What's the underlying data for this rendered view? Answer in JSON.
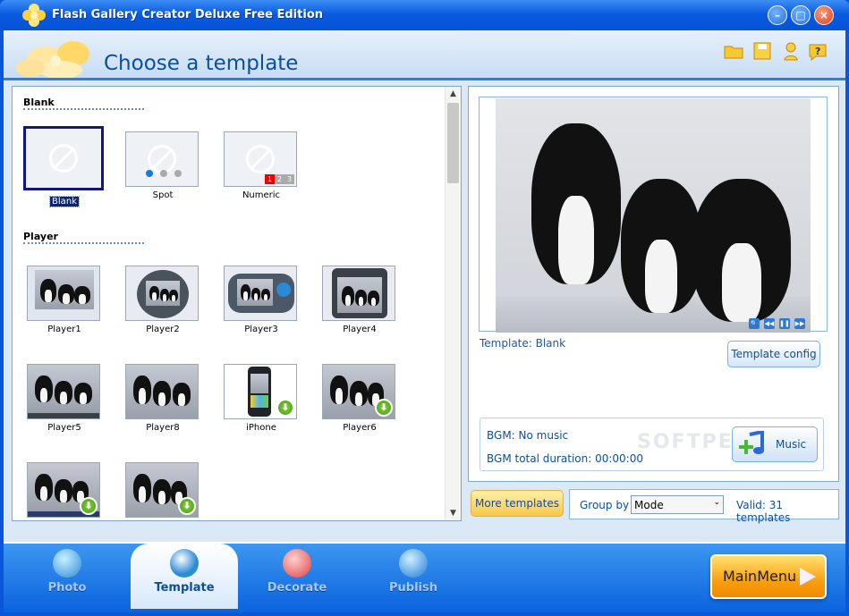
{
  "window": {
    "title": "Flash Gallery Creator Deluxe Free Edition",
    "buttons": [
      "minimize-icon",
      "maximize-icon",
      "close-icon"
    ]
  },
  "header": {
    "page_title": "Choose a template",
    "icons": [
      "folder-icon",
      "save-icon",
      "help-person-icon",
      "help-icon"
    ]
  },
  "templates": {
    "sections": [
      {
        "title": "Blank",
        "items": [
          "Blank",
          "Spot",
          "Numeric"
        ]
      },
      {
        "title": "Player",
        "items": [
          "Player1",
          "Player2",
          "Player3",
          "Player4",
          "Player5",
          "Player8",
          "iPhone",
          "Player6",
          "",
          ""
        ]
      }
    ],
    "numeric_labels": [
      "1",
      "2",
      "3"
    ],
    "selected": "Blank"
  },
  "preview": {
    "template_info": "Template: Blank",
    "template_config_label": "Template config",
    "bgm_label": "BGM: No music",
    "bgm_duration": "BGM total duration: 00:00:00",
    "music_label": "Music",
    "watermark": "SOFTPEDIA"
  },
  "toolbar": {
    "more_templates_label": "More templates",
    "group_by_label": "Group by",
    "group_by_value": "Mode",
    "valid_text": "Valid: 31 templates"
  },
  "bottom_nav": {
    "tabs": [
      "Photo",
      "Template",
      "Decorate",
      "Publish"
    ],
    "active": "Template",
    "main_menu_label": "MainMenu"
  },
  "colors": {
    "accent": "#0a56d8",
    "title_text": "#0b4f9a",
    "selection": "#101880"
  }
}
